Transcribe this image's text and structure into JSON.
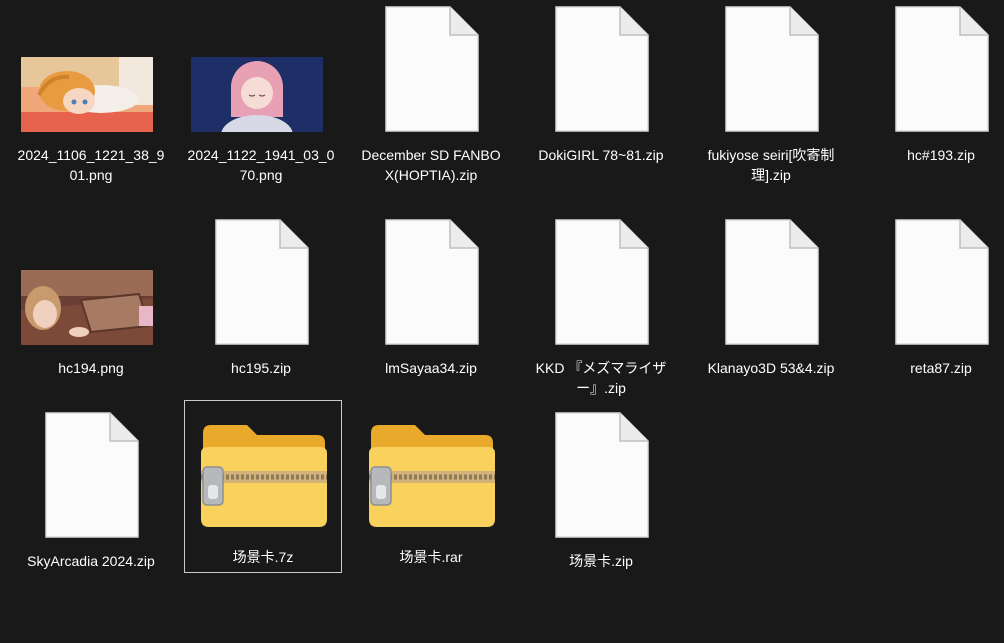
{
  "files": [
    {
      "name": "2024_1106_1221_38_901.png",
      "kind": "image",
      "thumb": "girl-lying"
    },
    {
      "name": "2024_1122_1941_03_070.png",
      "kind": "image",
      "thumb": "pink-hair"
    },
    {
      "name": "December SD FANBOX(HOPTIA).zip",
      "kind": "document"
    },
    {
      "name": "DokiGIRL 78~81.zip",
      "kind": "document"
    },
    {
      "name": "fukiyose seiri[吹寄制理].zip",
      "kind": "document"
    },
    {
      "name": "hc#193.zip",
      "kind": "document"
    },
    {
      "name": "hc194.png",
      "kind": "image",
      "thumb": "room"
    },
    {
      "name": "hc195.zip",
      "kind": "document"
    },
    {
      "name": "lmSayaa34.zip",
      "kind": "document"
    },
    {
      "name": "KKD 『メズマライザー』.zip",
      "kind": "document"
    },
    {
      "name": "Klanayo3D 53&4.zip",
      "kind": "document"
    },
    {
      "name": "reta87.zip",
      "kind": "document"
    },
    {
      "name": "SkyArcadia 2024.zip",
      "kind": "document"
    },
    {
      "name": "场景卡.7z",
      "kind": "zip-folder",
      "selected": true
    },
    {
      "name": "场景卡.rar",
      "kind": "zip-folder"
    },
    {
      "name": "场景卡.zip",
      "kind": "document"
    }
  ],
  "colors": {
    "background": "#191919",
    "selection_border": "#c9c9c9",
    "label_text": "#ffffff",
    "folder_yellow": "#f6c94a"
  }
}
